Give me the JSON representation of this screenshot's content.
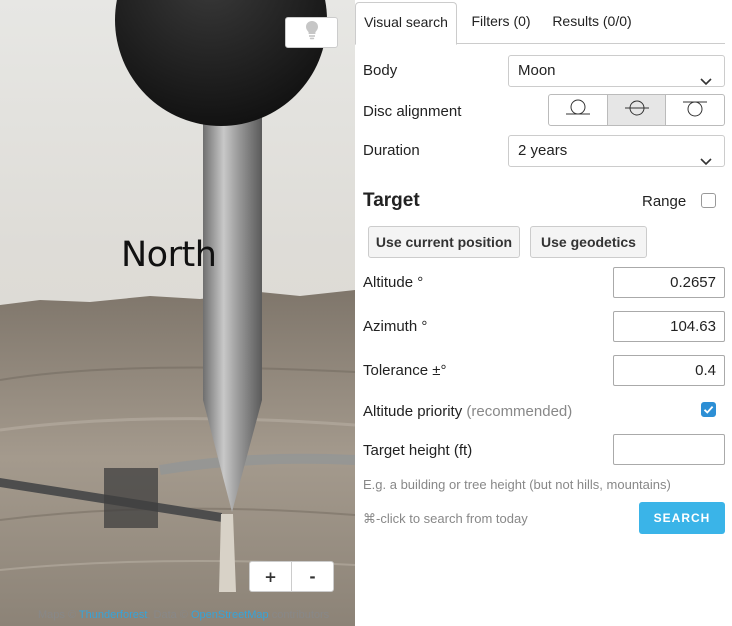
{
  "view": {
    "north_label": "North",
    "attribution": {
      "prefix": "Maps ©",
      "provider": "Thunderforest",
      "middle": ", Data ©",
      "source": "OpenStreetMap",
      "suffix": "contributors"
    },
    "zoom_in_label": "+",
    "zoom_out_label": "-",
    "hint_icon": "lightbulb-icon"
  },
  "tabs": [
    {
      "label": "Visual search",
      "active": true
    },
    {
      "label": "Filters (0)",
      "active": false
    },
    {
      "label": "Results (0/0)",
      "active": false
    }
  ],
  "form": {
    "body_label": "Body",
    "body_value": "Moon",
    "disc_alignment_label": "Disc alignment",
    "disc_alignment_options": [
      "bottom-edge",
      "center",
      "top-edge"
    ],
    "disc_alignment_selected": "center",
    "duration_label": "Duration",
    "duration_value": "2 years",
    "target_title": "Target",
    "range_label": "Range",
    "range_checked": false,
    "use_current_position_label": "Use current position",
    "use_geodetics_label": "Use geodetics",
    "altitude_label": "Altitude °",
    "altitude_value": "0.2657",
    "azimuth_label": "Azimuth °",
    "azimuth_value": "104.63",
    "tolerance_label": "Tolerance ±°",
    "tolerance_value": "0.4",
    "altitude_priority_label": "Altitude priority",
    "altitude_priority_note": "(recommended)",
    "altitude_priority_checked": true,
    "target_height_label": "Target height (ft)",
    "target_height_value": "",
    "target_height_hint": "E.g. a building or tree height (but not hills, mountains)",
    "search_hint": "⌘-click to search from today",
    "search_label": "SEARCH"
  },
  "colors": {
    "accent": "#3ab4e8",
    "checkbox": "#2d8fd5"
  }
}
